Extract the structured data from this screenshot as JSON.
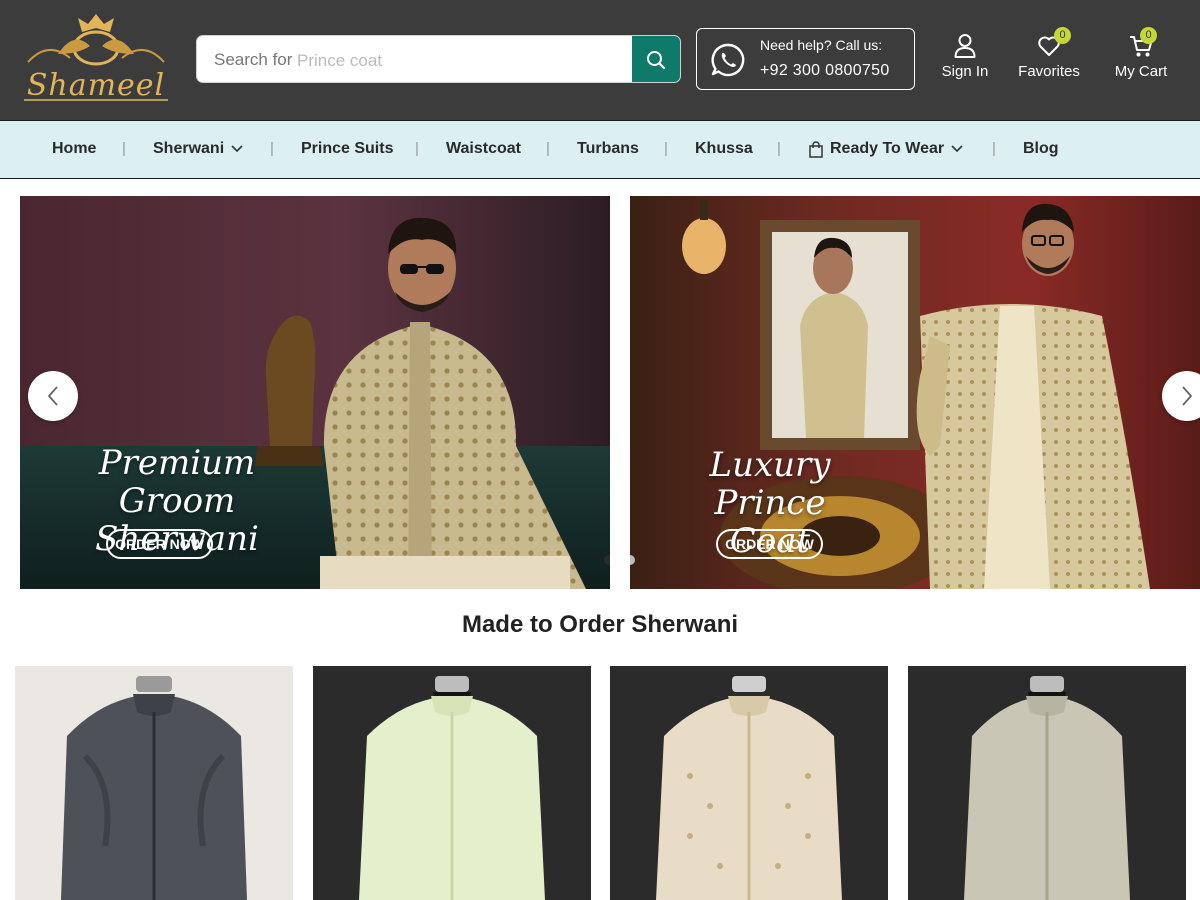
{
  "brand": {
    "name": "Shameel"
  },
  "search": {
    "prefix": "Search for",
    "placeholder": "Prince coat"
  },
  "help": {
    "line1": "Need help? Call us:",
    "phone": "+92 300 0800750"
  },
  "header_actions": {
    "signin": "Sign In",
    "favorites": "Favorites",
    "favorites_count": "0",
    "cart": "My Cart",
    "cart_count": "0"
  },
  "nav": {
    "items": [
      {
        "label": "Home"
      },
      {
        "label": "Sherwani"
      },
      {
        "label": "Prince Suits"
      },
      {
        "label": "Waistcoat"
      },
      {
        "label": "Turbans"
      },
      {
        "label": "Khussa"
      },
      {
        "label": "Ready To Wear"
      },
      {
        "label": "Blog"
      }
    ],
    "separator": "|"
  },
  "banners": [
    {
      "title_line1": "Premium Groom",
      "title_line2": "Sherwani",
      "button": "ORDER NOW"
    },
    {
      "title_line1": "Luxury",
      "title_line2": "Prince Coat",
      "button": "ORDER NOW"
    }
  ],
  "section": {
    "title": "Made to Order Sherwani"
  },
  "colors": {
    "header_bg": "#3c3c3c",
    "nav_bg": "#dcf0f2",
    "search_button": "#0f7a6a",
    "badge": "#c7d637",
    "logo_gold": "#e2b55a"
  },
  "icons": {
    "search": "magnifier-icon",
    "help": "whatsapp-icon",
    "signin": "user-icon",
    "favorites": "heart-icon",
    "cart": "cart-icon",
    "nav_dropdown": "chevron-down-icon",
    "ready_to_wear": "shopping-bag-icon",
    "carousel_prev": "chevron-left-icon",
    "carousel_next": "chevron-right-icon"
  }
}
